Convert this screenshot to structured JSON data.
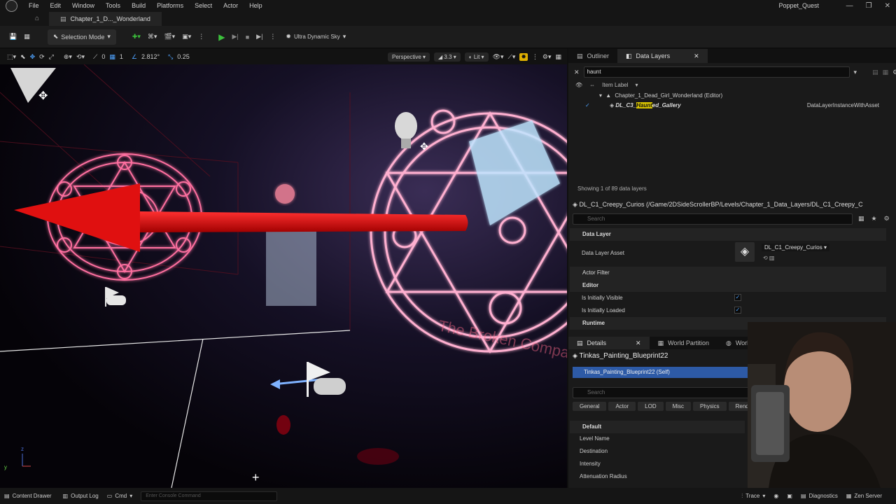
{
  "app": {
    "project_name": "Poppet_Quest",
    "menu": [
      "File",
      "Edit",
      "Window",
      "Tools",
      "Build",
      "Platforms",
      "Select",
      "Actor",
      "Help"
    ],
    "level_tab": "Chapter_1_D..._Wonderland",
    "window_controls": [
      "—",
      "❐",
      "✕"
    ]
  },
  "toolbar": {
    "selection_mode": "Selection Mode",
    "sky_label": "Ultra Dynamic Sky"
  },
  "viewport_bar": {
    "grid_rotation_value": "1",
    "angle_value": "0",
    "scale_value": "2.812°",
    "snap_value": "0.25",
    "perspective": "Perspective",
    "fov": "3.3",
    "lit": "Lit"
  },
  "viewport": {
    "overlay_text": "The Broken Compass",
    "axis_z": "z",
    "axis_y": "y",
    "axis_x": "x"
  },
  "outliner": {
    "tab_outliner": "Outliner",
    "tab_data_layers": "Data Layers",
    "filter_value": "haunt",
    "column_item_label": "Item Label",
    "tree_root": "Chapter_1_Dead_Girl_Wonderland (Editor)",
    "tree_child_prefix": "DL_C3_",
    "tree_child_highlight": "Haunt",
    "tree_child_suffix": "ed_Gallery",
    "tree_child_type": "DataLayerInstanceWithAsset",
    "count_text": "Showing 1 of 89 data layers"
  },
  "data_layer_details": {
    "path": "DL_C1_Creepy_Curios (/Game/2DSideScrollerBP/Levels/Chapter_1_Data_Layers/DL_C1_Creepy_C",
    "search_placeholder": "Search",
    "section_data_layer": "Data Layer",
    "asset_label": "Data Layer Asset",
    "asset_value": "DL_C1_Creepy_Curios",
    "section_actor_filter": "Actor Filter",
    "section_editor": "Editor",
    "visible_label": "Is Initially Visible",
    "loaded_label": "Is Initially Loaded",
    "section_runtime": "Runtime"
  },
  "details": {
    "tab_details": "Details",
    "tab_world_partition": "World Partition",
    "tab_world_settings": "World Settings",
    "actor_name": "Tinkas_Painting_Blueprint22",
    "self_row": "Tinkas_Painting_Blueprint22 (Self)",
    "search_placeholder": "Search",
    "categories": [
      "General",
      "Actor",
      "LOD",
      "Misc",
      "Physics",
      "Rende"
    ],
    "section_default": "Default",
    "props": [
      "Level Name",
      "Destination",
      "Intensity",
      "Attenuation Radius"
    ]
  },
  "statusbar": {
    "content_drawer": "Content Drawer",
    "output_log": "Output Log",
    "cmd": "Cmd",
    "console_placeholder": "Enter Console Command",
    "trace": "Trace",
    "diagnostics": "Diagnostics",
    "zen_server": "Zen Server"
  },
  "colors": {
    "accent_blue": "#2d5aa6",
    "highlight_yellow": "#d8c400",
    "play_green": "#3cc13c",
    "gizmo_red": "#e01010",
    "circle_glow": "#ff4d8a"
  }
}
